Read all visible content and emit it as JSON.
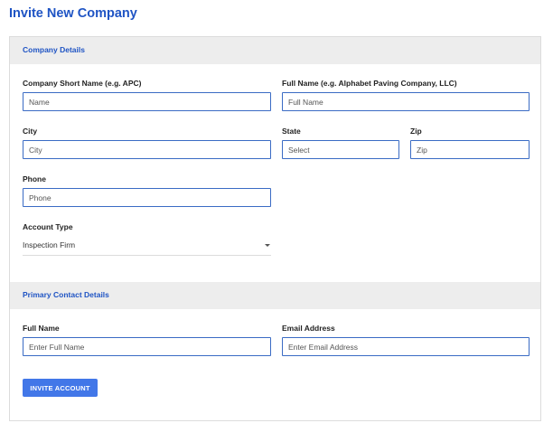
{
  "page": {
    "title": "Invite New Company"
  },
  "company_details": {
    "header": "Company Details",
    "short_name": {
      "label": "Company Short Name (e.g. APC)",
      "placeholder": "Name",
      "value": ""
    },
    "full_name": {
      "label": "Full Name (e.g. Alphabet Paving Company, LLC)",
      "placeholder": "Full Name",
      "value": ""
    },
    "city": {
      "label": "City",
      "placeholder": "City",
      "value": ""
    },
    "state": {
      "label": "State",
      "placeholder": "Select",
      "value": ""
    },
    "zip": {
      "label": "Zip",
      "placeholder": "Zip",
      "value": ""
    },
    "phone": {
      "label": "Phone",
      "placeholder": "Phone",
      "value": ""
    },
    "account_type": {
      "label": "Account Type",
      "selected": "Inspection Firm",
      "icon": "caret-down-icon"
    }
  },
  "primary_contact": {
    "header": "Primary Contact Details",
    "full_name": {
      "label": "Full Name",
      "placeholder": "Enter Full Name",
      "value": ""
    },
    "email": {
      "label": "Email Address",
      "placeholder": "Enter Email Address",
      "value": ""
    }
  },
  "actions": {
    "invite_label": "INVITE ACCOUNT"
  },
  "colors": {
    "accent": "#1f54c4",
    "button": "#4277e8",
    "input_border": "#3a6bc4",
    "section_bg": "#ededed"
  }
}
